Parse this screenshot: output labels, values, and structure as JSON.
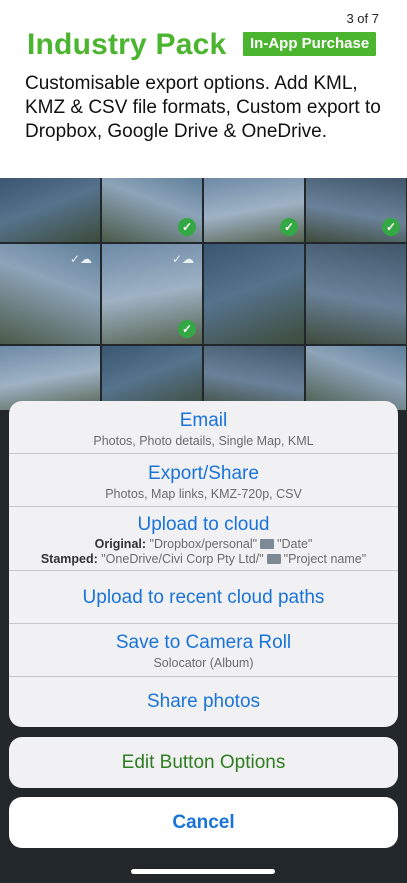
{
  "header": {
    "page_indicator": "3 of 7",
    "title": "Industry Pack",
    "badge": "In-App Purchase",
    "description": "Customisable export options. Add KML, KMZ & CSV file formats, Custom export to Dropbox, Google Drive & OneDrive."
  },
  "sheet": {
    "options": [
      {
        "title": "Email",
        "subtitle": "Photos, Photo details, Single Map, KML"
      },
      {
        "title": "Export/Share",
        "subtitle": "Photos, Map links, KMZ-720p, CSV"
      },
      {
        "title": "Upload to cloud",
        "original_label": "Original:",
        "original_path": "\"Dropbox/personal\"",
        "original_folder": "\"Date\"",
        "stamped_label": "Stamped:",
        "stamped_path": "\"OneDrive/Civi Corp Pty Ltd/\"",
        "stamped_folder": "\"Project name\""
      },
      {
        "title": "Upload to recent cloud paths"
      },
      {
        "title": "Save to Camera Roll",
        "subtitle": "Solocator (Album)"
      },
      {
        "title": "Share photos"
      }
    ],
    "edit_button": "Edit Button Options",
    "cancel_button": "Cancel"
  },
  "colors": {
    "brand_green": "#4cb52f",
    "ios_blue": "#1a73d9",
    "edit_green": "#2f7d22"
  }
}
